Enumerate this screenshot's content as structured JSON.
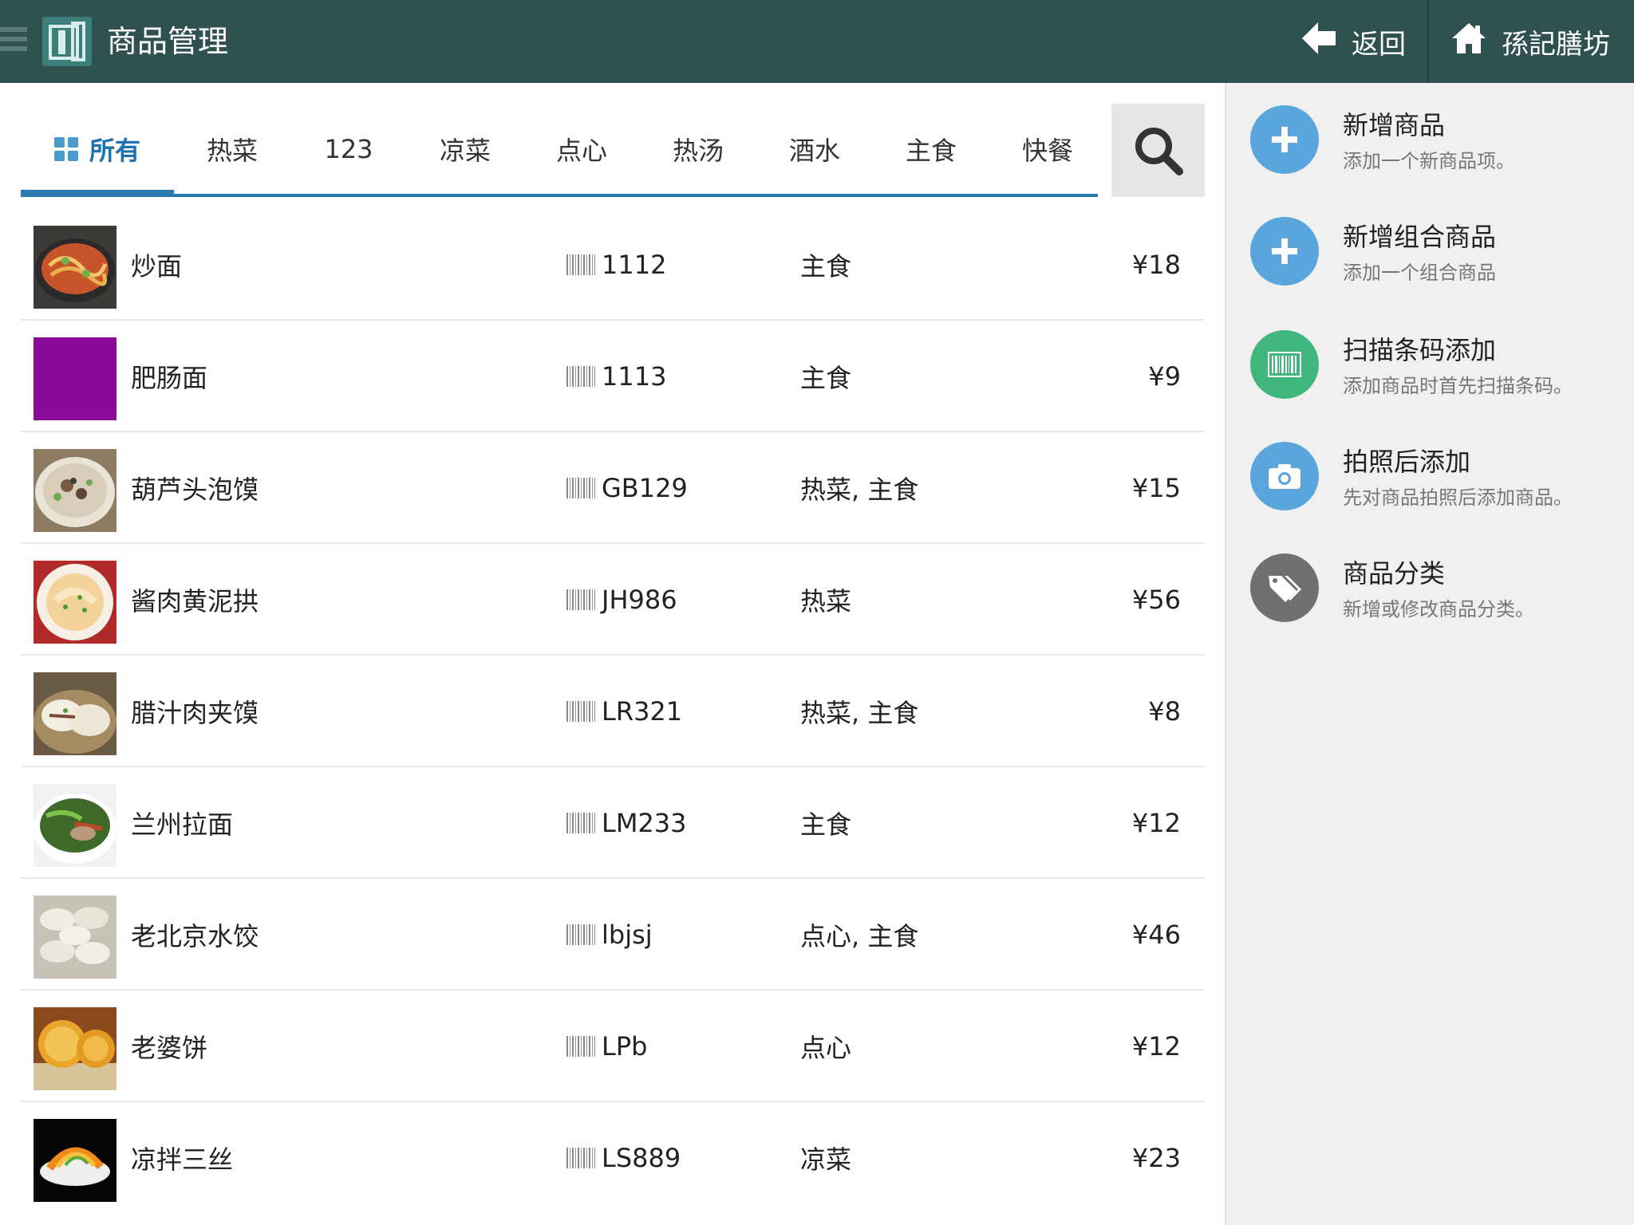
{
  "header": {
    "title": "商品管理",
    "back_label": "返回",
    "home_label": "孫記膳坊"
  },
  "tabs": [
    {
      "label": "所有",
      "active": true
    },
    {
      "label": "热菜"
    },
    {
      "label": "123"
    },
    {
      "label": "凉菜"
    },
    {
      "label": "点心"
    },
    {
      "label": "热汤"
    },
    {
      "label": "酒水"
    },
    {
      "label": "主食"
    },
    {
      "label": "快餐"
    }
  ],
  "products": [
    {
      "name": "炒面",
      "code": "1112",
      "category": "主食",
      "price": "¥18",
      "thumb": "noodles-fried"
    },
    {
      "name": "肥肠面",
      "code": "1113",
      "category": "主食",
      "price": "¥9",
      "thumb": "purple-placeholder"
    },
    {
      "name": "葫芦头泡馍",
      "code": "GB129",
      "category": "热菜, 主食",
      "price": "¥15",
      "thumb": "soup-bowl"
    },
    {
      "name": "酱肉黄泥拱",
      "code": "JH986",
      "category": "热菜",
      "price": "¥56",
      "thumb": "plate-dish"
    },
    {
      "name": "腊汁肉夹馍",
      "code": "LR321",
      "category": "热菜, 主食",
      "price": "¥8",
      "thumb": "buns"
    },
    {
      "name": "兰州拉面",
      "code": "LM233",
      "category": "主食",
      "price": "¥12",
      "thumb": "noodle-soup"
    },
    {
      "name": "老北京水饺",
      "code": "lbjsj",
      "category": "点心, 主食",
      "price": "¥46",
      "thumb": "dumplings"
    },
    {
      "name": "老婆饼",
      "code": "LPb",
      "category": "点心",
      "price": "¥12",
      "thumb": "pastry"
    },
    {
      "name": "凉拌三丝",
      "code": "LS889",
      "category": "凉菜",
      "price": "¥23",
      "thumb": "cold-salad"
    }
  ],
  "actions": [
    {
      "title": "新增商品",
      "subtitle": "添加一个新商品项。",
      "icon": "plus-icon",
      "color": "#5aa5db"
    },
    {
      "title": "新增组合商品",
      "subtitle": "添加一个组合商品",
      "icon": "plus-icon",
      "color": "#5aa5db"
    },
    {
      "title": "扫描条码添加",
      "subtitle": "添加商品时首先扫描条码。",
      "icon": "barcode-icon",
      "color": "#3fb77c"
    },
    {
      "title": "拍照后添加",
      "subtitle": "先对商品拍照后添加商品。",
      "icon": "camera-icon",
      "color": "#5aa5db"
    },
    {
      "title": "商品分类",
      "subtitle": "新增或修改商品分类。",
      "icon": "tag-icon",
      "color": "#707070"
    }
  ],
  "colors": {
    "topbar": "#2f5150",
    "tab_accent": "#2a7ab0",
    "side_panel": "#f0f0f0"
  }
}
